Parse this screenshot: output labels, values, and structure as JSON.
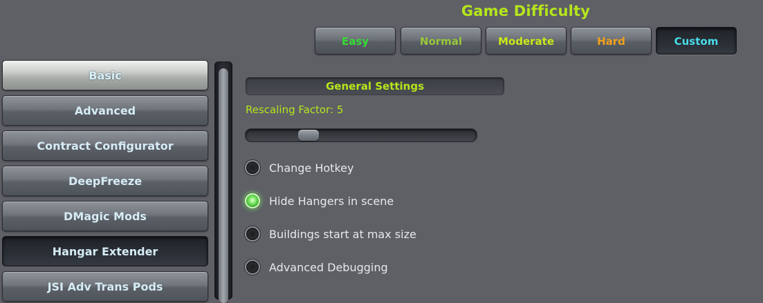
{
  "difficulty": {
    "title": "Game Difficulty",
    "buttons": [
      {
        "label": "Easy",
        "color": "#35dd35"
      },
      {
        "label": "Normal",
        "color": "#97c83a"
      },
      {
        "label": "Moderate",
        "color": "#c9e81a"
      },
      {
        "label": "Hard",
        "color": "#f3a21b"
      },
      {
        "label": "Custom",
        "color": "#48dcea"
      }
    ],
    "selected": "Custom"
  },
  "categories": {
    "items": [
      {
        "label": "Basic"
      },
      {
        "label": "Advanced"
      },
      {
        "label": "Contract Configurator"
      },
      {
        "label": "DeepFreeze"
      },
      {
        "label": "DMagic Mods"
      },
      {
        "label": "Hangar Extender"
      },
      {
        "label": "JSI Adv Trans Pods"
      }
    ],
    "selected": "Hangar Extender"
  },
  "settings": {
    "section_title": "General Settings",
    "rescaling_label": "Rescaling Factor: 5",
    "slider": {
      "value_fraction": 0.25
    },
    "toggles": [
      {
        "label": "Change Hotkey",
        "on": false
      },
      {
        "label": "Hide Hangers in scene",
        "on": true
      },
      {
        "label": "Buildings start at max size",
        "on": false
      },
      {
        "label": "Advanced Debugging",
        "on": false
      }
    ]
  },
  "colors": {
    "accent": "#b6e61b",
    "toggle_on": "#5fdc48"
  }
}
